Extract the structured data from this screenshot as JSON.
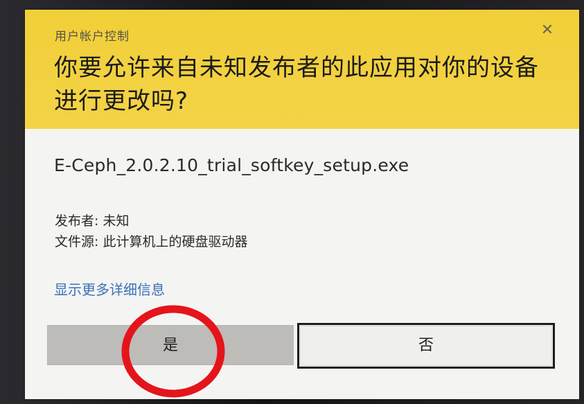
{
  "dialog": {
    "window_title": "用户帐户控制",
    "close_symbol": "✕",
    "headline": "你要允许来自未知发布者的此应用对你的设备进行更改吗?",
    "program_name": "E-Ceph_2.0.2.10_trial_softkey_setup.exe",
    "publisher": "发布者: 未知",
    "file_origin": "文件源: 此计算机上的硬盘驱动器",
    "details_link": "显示更多详细信息",
    "yes_label": "是",
    "no_label": "否"
  },
  "colors": {
    "header": "#f3d140",
    "body": "#f4f4f2",
    "link": "#3a71b9",
    "annotation": "#e5141b"
  },
  "annotation": {
    "shape": "circle",
    "target": "yes-button"
  }
}
